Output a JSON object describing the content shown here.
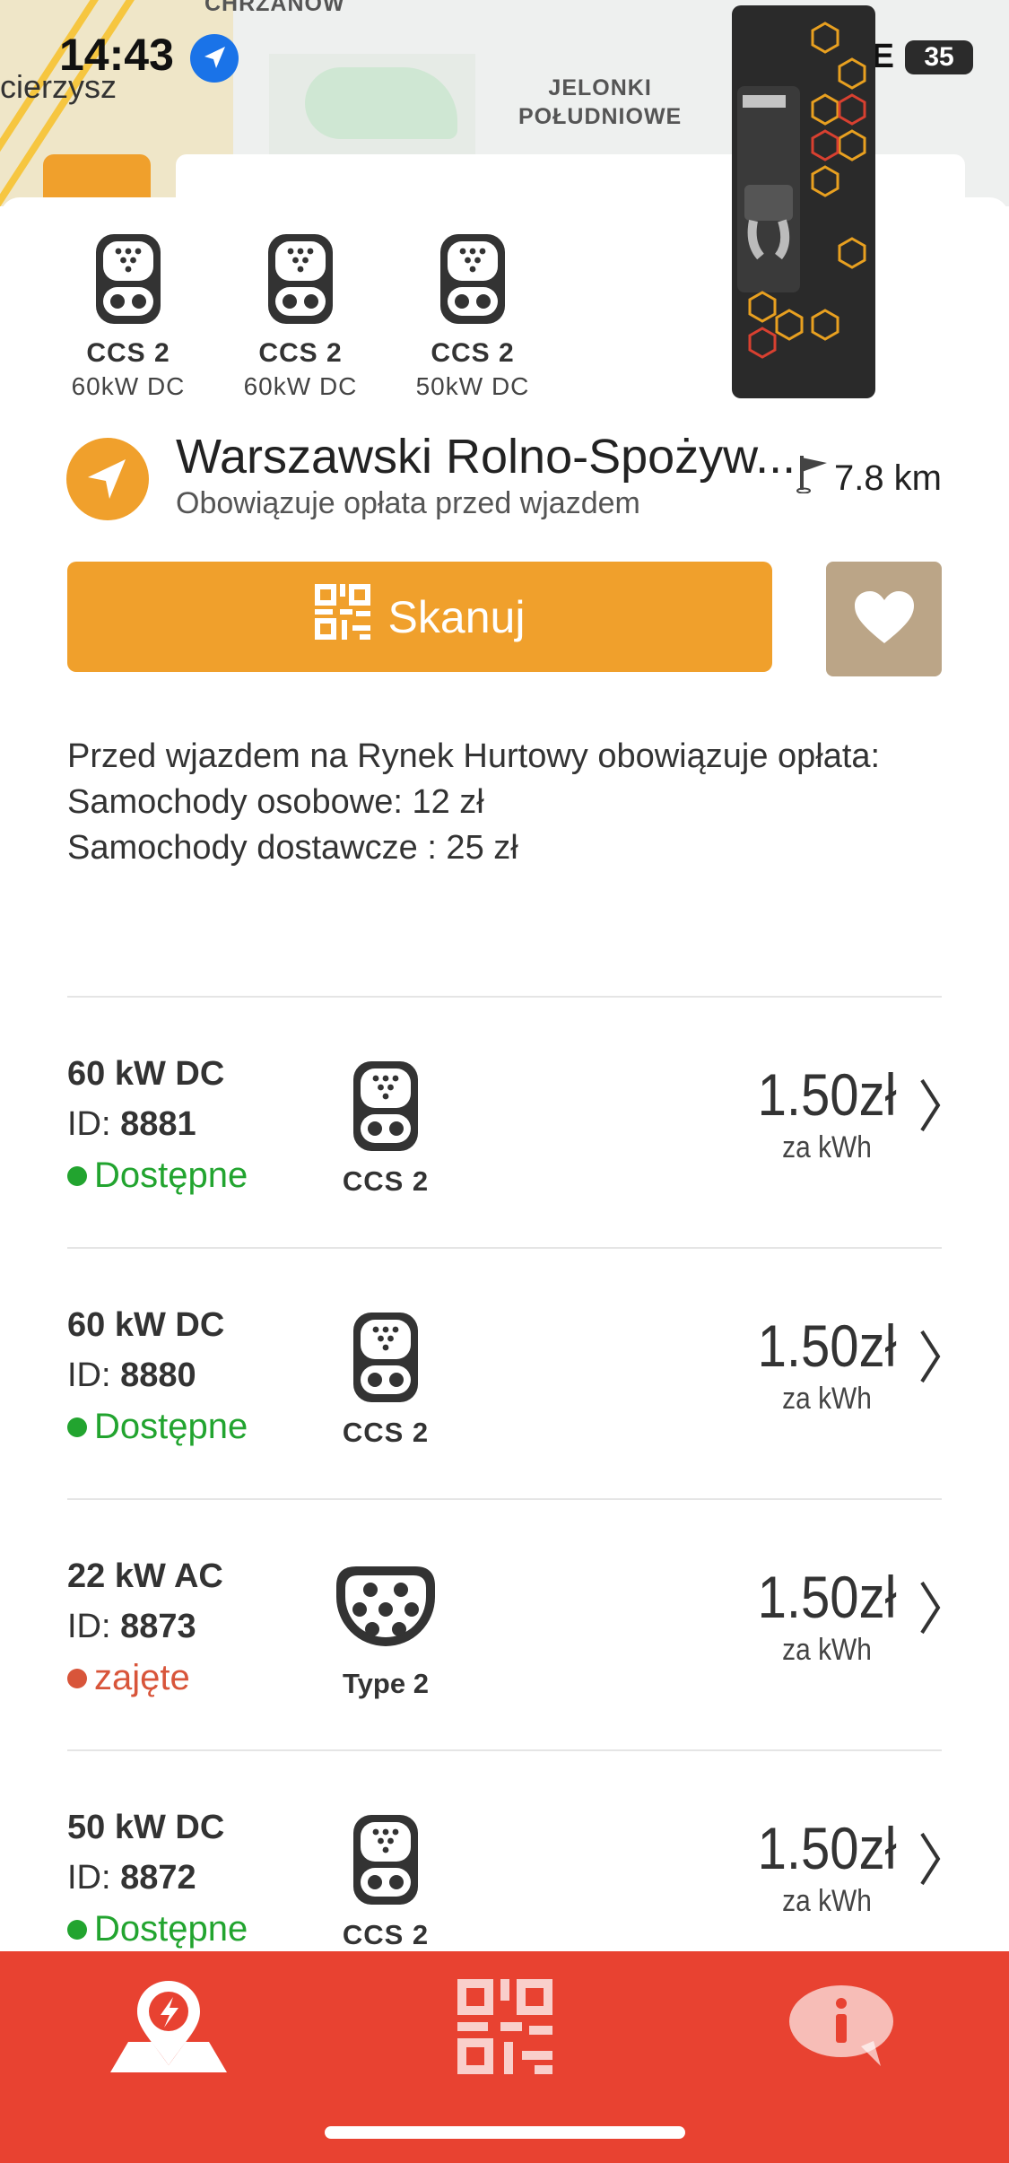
{
  "status_bar": {
    "time": "14:43",
    "network": "LTE",
    "battery": "35"
  },
  "map": {
    "label_top": "CHRZANÓW",
    "label_left": "cierzysz",
    "label_district": "JELONKI\nPOŁUDNIOWE"
  },
  "search": {
    "placeholder": ""
  },
  "summary_connectors": [
    {
      "name": "CCS 2",
      "power": "60kW DC",
      "icon": "ccs2-icon"
    },
    {
      "name": "CCS 2",
      "power": "60kW DC",
      "icon": "ccs2-icon"
    },
    {
      "name": "CCS 2",
      "power": "50kW DC",
      "icon": "ccs2-icon"
    }
  ],
  "site": {
    "name": "Warszawski Rolno-Spożyw...",
    "subtitle": "Obowiązuje opłata przed wjazdem",
    "distance": "7.8 km"
  },
  "actions": {
    "scan_label": "Skanuj"
  },
  "info": {
    "lines": [
      "Przed wjazdem na Rynek Hurtowy obowiązuje opłata:",
      "Samochody osobowe: 12 zł",
      "Samochody dostawcze : 25 zł"
    ]
  },
  "points": [
    {
      "power": "60 kW DC",
      "id_label": "ID: ",
      "id": "8881",
      "status": "Dostępne",
      "status_color": "#22a42f",
      "plug": "CCS 2",
      "plug_icon": "ccs2-icon",
      "price": "1.50zł",
      "unit": "za kWh"
    },
    {
      "power": "60 kW DC",
      "id_label": "ID: ",
      "id": "8880",
      "status": "Dostępne",
      "status_color": "#22a42f",
      "plug": "CCS 2",
      "plug_icon": "ccs2-icon",
      "price": "1.50zł",
      "unit": "za kWh"
    },
    {
      "power": "22 kW AC",
      "id_label": "ID: ",
      "id": "8873",
      "status": "zajęte",
      "status_color": "#d8553a",
      "plug": "Type 2",
      "plug_icon": "type2-icon",
      "price": "1.50zł",
      "unit": "za kWh"
    },
    {
      "power": "50 kW DC",
      "id_label": "ID: ",
      "id": "8872",
      "status": "Dostępne",
      "status_color": "#22a42f",
      "plug": "CCS 2",
      "plug_icon": "ccs2-icon",
      "price": "1.50zł",
      "unit": "za kWh"
    }
  ],
  "tabbar": {
    "items": [
      {
        "name": "map-charging-icon"
      },
      {
        "name": "qr-code-icon"
      },
      {
        "name": "info-chat-icon"
      }
    ]
  },
  "colors": {
    "accent": "#f0a02c",
    "tabbar": "#e84231",
    "favorite": "#bba587",
    "available": "#22a42f",
    "occupied": "#d8553a"
  }
}
